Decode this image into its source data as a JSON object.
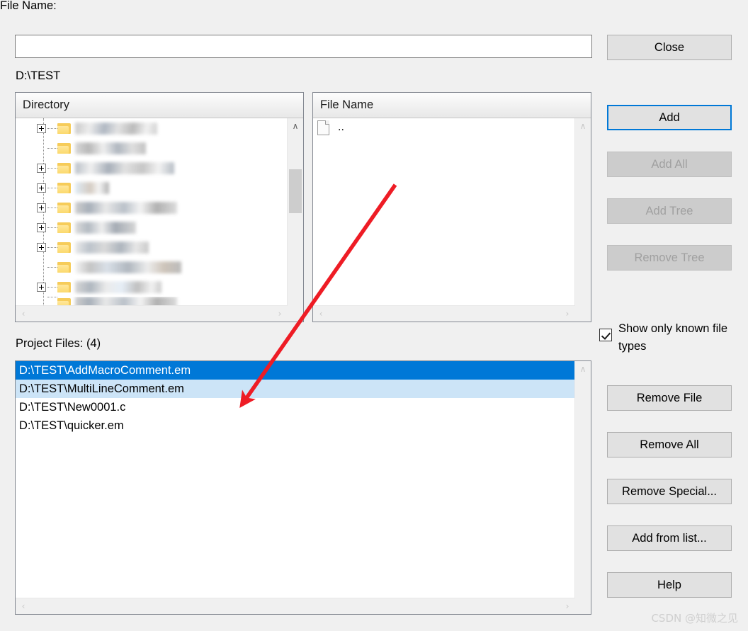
{
  "dialog": {
    "file_name_label": "File Name:",
    "file_name_value": "",
    "file_name_placeholder": "",
    "current_path": "D:\\TEST",
    "project_files_label": "Project Files: (4)",
    "watermark": "CSDN @知微之见"
  },
  "directory_panel": {
    "header": "Directory",
    "rows": [
      {
        "expandable": true,
        "name_blur": "b1"
      },
      {
        "expandable": false,
        "name_blur": "b2"
      },
      {
        "expandable": true,
        "name_blur": "b3"
      },
      {
        "expandable": true,
        "name_blur": "b4"
      },
      {
        "expandable": true,
        "name_blur": "b5"
      },
      {
        "expandable": true,
        "name_blur": "b6"
      },
      {
        "expandable": true,
        "name_blur": "b7"
      },
      {
        "expandable": false,
        "name_blur": "b8"
      },
      {
        "expandable": true,
        "name_blur": "b9"
      }
    ]
  },
  "file_list_panel": {
    "header": "File Name",
    "rows": [
      {
        "name": ".."
      }
    ]
  },
  "project_files_panel": {
    "rows": [
      {
        "path": "D:\\TEST\\AddMacroComment.em",
        "state": "sel-primary"
      },
      {
        "path": "D:\\TEST\\MultiLineComment.em",
        "state": "sel-secondary"
      },
      {
        "path": "D:\\TEST\\New0001.c",
        "state": "normal"
      },
      {
        "path": "D:\\TEST\\quicker.em",
        "state": "normal"
      }
    ]
  },
  "buttons": {
    "close": "Close",
    "add": "Add",
    "add_all": "Add All",
    "add_tree": "Add Tree",
    "remove_tree": "Remove Tree",
    "remove_file": "Remove File",
    "remove_all": "Remove All",
    "remove_special": "Remove Special...",
    "add_from_list": "Add from list...",
    "help": "Help"
  },
  "checkbox": {
    "label": "Show only known file types",
    "checked": true
  },
  "colors": {
    "selection_primary": "#0078d7",
    "selection_secondary": "#cce4f7",
    "focus_border": "#0078d7",
    "dialog_background": "#f0f0f0",
    "annotation_arrow": "#ee1c25"
  },
  "scrollbars": {
    "arrow_up": "∧",
    "arrow_down": "∨",
    "arrow_left": "‹",
    "arrow_right": "›"
  }
}
